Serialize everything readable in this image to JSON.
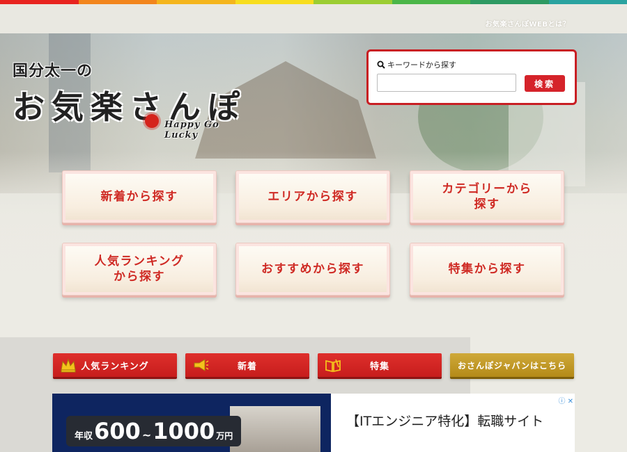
{
  "colors": {
    "strip": [
      "#e8231f",
      "#f2851c",
      "#f4b51c",
      "#f7dd1e",
      "#9bcd32",
      "#4bb648",
      "#2e9a63",
      "#2aa3a0"
    ],
    "accent_red": "#cf2a24",
    "gold": "#b48a18"
  },
  "header": {
    "about_link": "お気楽さんぽWEBとは？"
  },
  "logo": {
    "line1": "国分太一の",
    "line2": "お気楽さんぽ",
    "tagline": "Happy Go Lucky"
  },
  "search": {
    "label": "キーワードから探す",
    "icon": "search-icon",
    "placeholder": "",
    "value": "",
    "button": "検索"
  },
  "nav": {
    "items": [
      {
        "label": "新着から探す"
      },
      {
        "label": "エリアから探す"
      },
      {
        "label": "カテゴリーから\n探す"
      },
      {
        "label": "人気ランキング\nから探す"
      },
      {
        "label": "おすすめから探す"
      },
      {
        "label": "特集から探す"
      }
    ]
  },
  "tabs": [
    {
      "label": "人気ランキング",
      "icon": "crown-icon"
    },
    {
      "label": "新着",
      "icon": "megaphone-icon"
    },
    {
      "label": "特集",
      "icon": "book-icon"
    },
    {
      "label": "おさんぽジャパンはこちら"
    }
  ],
  "ad": {
    "salary_label": "年収",
    "salary_from": "600",
    "salary_tilde": "~",
    "salary_to": "1000",
    "salary_unit": "万円",
    "headline": "【ITエンジニア特化】転職サイト",
    "choice": "ⓘ ✕"
  }
}
